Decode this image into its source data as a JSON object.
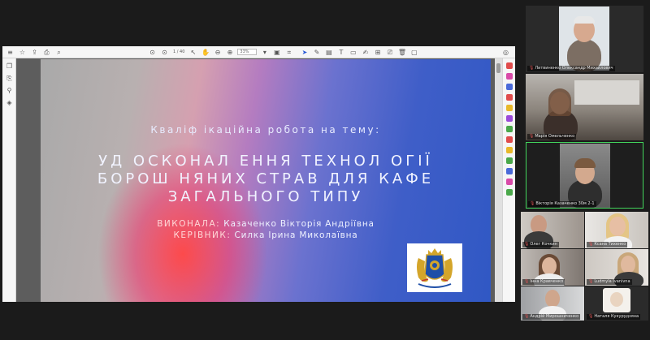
{
  "pdf_viewer": {
    "page_indicator": "1 / 40",
    "zoom_value": "33%"
  },
  "slide": {
    "subtitle": "Кваліф ікаційна робота на тему:",
    "title_line1": "УД ОСКОНАЛ ЕННЯ ТЕХНОЛ ОГІЇ",
    "title_line2": "БОРОШ НЯНИХ СТРАВ ДЛЯ КАФЕ",
    "title_line3": "ЗАГАЛЬНОГО ТИПУ",
    "author_role": "ВИКОНАЛА:",
    "author_name": " Казаченко Вікторія Андріївна",
    "supervisor_role": "КЕРІВНИК:",
    "supervisor_name": " Силка Ірина Миколаївна"
  },
  "participants": [
    {
      "name": "Литвиненко Олександр Михайлович"
    },
    {
      "name": "Марія Омельченко"
    },
    {
      "name": "Вікторія Казаченко 30м 2-1"
    },
    {
      "name": "Олег Кочкин"
    },
    {
      "name": "Ксана Тихенко"
    },
    {
      "name": "Інна Кравченко"
    },
    {
      "name": "Ludmyla Ivanivna"
    },
    {
      "name": "Андрій Мирошниченко"
    },
    {
      "name": "Наталя Кукурудзяна"
    }
  ],
  "colors": {
    "active_speaker_border": "#42d45c",
    "slide_text": "#eef1ff",
    "toolbar_accent": "#2a5bd7"
  }
}
